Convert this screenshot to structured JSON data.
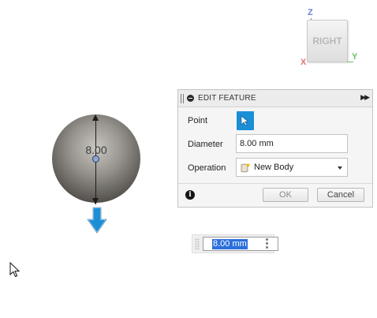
{
  "viewcube": {
    "face_label": "RIGHT",
    "axis_z": "Z",
    "axis_y": "Y",
    "axis_x": "X",
    "colors": {
      "z": "#6f7ed8",
      "y": "#6bbf6b",
      "x": "#e07474"
    }
  },
  "canvas": {
    "dimension_label": "8.00",
    "manipulator_color": "#1a8fd6"
  },
  "dialog": {
    "title": "EDIT FEATURE",
    "point_label": "Point",
    "diameter_label": "Diameter",
    "diameter_value": "8.00 mm",
    "operation_label": "Operation",
    "operation_value": "New Body",
    "ok_label": "OK",
    "cancel_label": "Cancel",
    "accent_color": "#1a8fd6"
  },
  "floating_input": {
    "value": "8.00 mm"
  },
  "icons": {
    "collapse": "minus-circle-icon",
    "expand": "double-chevron-right-icon",
    "select": "cursor-arrow-icon",
    "body": "new-body-icon",
    "info": "info-icon",
    "more": "kebab-menu-icon",
    "pointer": "mouse-pointer-icon"
  }
}
